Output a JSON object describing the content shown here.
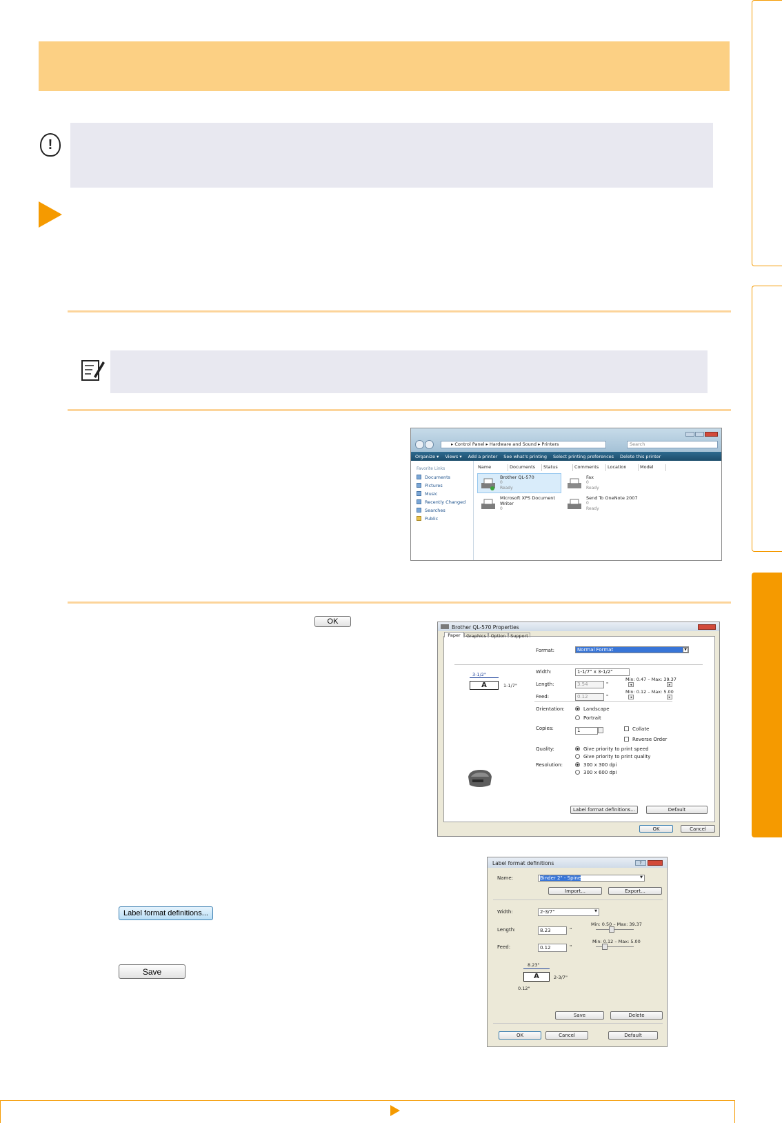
{
  "buttons": {
    "ok_inline": "OK",
    "label_format_definitions": "Label format definitions...",
    "save": "Save"
  },
  "caution": {
    "icon": "caution-icon"
  },
  "note": {
    "icon": "note-icon"
  },
  "explorer": {
    "breadcrumb": "▸ Control Panel ▸ Hardware and Sound ▸ Printers",
    "search_placeholder": "Search",
    "toolbar": [
      "Organize ▾",
      "Views ▾",
      "Add a printer",
      "See what's printing",
      "Select printing preferences",
      "Delete this printer"
    ],
    "sidebar_heading": "Favorite Links",
    "sidebar_links": [
      "Documents",
      "Pictures",
      "Music",
      "Recently Changed",
      "Searches",
      "Public"
    ],
    "columns": [
      "Name",
      "Documents",
      "Status",
      "Comments",
      "Location",
      "Model"
    ],
    "printers": [
      {
        "name": "Brother QL-570",
        "docs": "0",
        "status": "Ready"
      },
      {
        "name": "Fax",
        "docs": "0",
        "status": "Ready"
      },
      {
        "name": "Microsoft XPS Document Writer",
        "docs": "0",
        "status": ""
      },
      {
        "name": "Send To OneNote 2007",
        "docs": "0",
        "status": "Ready"
      }
    ]
  },
  "properties": {
    "title": "Brother QL-570 Properties",
    "tabs": [
      "Paper",
      "Graphics",
      "Option",
      "Support"
    ],
    "format_label": "Format:",
    "format_value": "Normal Format",
    "width_label": "Width:",
    "width_value": "1-1/7\" x 3-1/2\"",
    "length_label": "Length:",
    "length_value": "3.54",
    "feed_label": "Feed:",
    "feed_value": "0.12",
    "unit": "\"",
    "length_range": "Min: 0.47 – Max: 39.37",
    "feed_range": "Min: 0.12 – Max: 5.00",
    "preview_width": "3-1/2\"",
    "preview_height": "1-1/7\"",
    "preview_letter": "A",
    "orientation_label": "Orientation:",
    "orientation_options": [
      "Landscape",
      "Portrait"
    ],
    "copies_label": "Copies:",
    "copies_value": "1",
    "collate": "Collate",
    "reverse_order": "Reverse Order",
    "quality_label": "Quality:",
    "quality_options": [
      "Give priority to print speed",
      "Give priority to print quality"
    ],
    "resolution_label": "Resolution:",
    "resolution_options": [
      "300 x 300 dpi",
      "300 x 600 dpi"
    ],
    "label_format_button": "Label format definitions...",
    "default_button": "Default",
    "ok": "OK",
    "cancel": "Cancel"
  },
  "label_defs": {
    "title": "Label format definitions",
    "name_label": "Name:",
    "name_value": "Binder 2\" - Spine",
    "import": "Import...",
    "export": "Export...",
    "width_label": "Width:",
    "width_value": "2-3/7\"",
    "length_label": "Length:",
    "length_value": "8.23",
    "feed_label": "Feed:",
    "feed_value": "0.12",
    "unit": "\"",
    "length_range": "Min: 0.50 – Max: 39.37",
    "feed_range": "Min: 0.12 – Max: 5.00",
    "preview_width": "8.23\"",
    "preview_height": "2-3/7\"",
    "preview_feed": "0.12\"",
    "preview_letter": "A",
    "save": "Save",
    "delete": "Delete",
    "ok": "OK",
    "cancel": "Cancel",
    "default": "Default"
  }
}
